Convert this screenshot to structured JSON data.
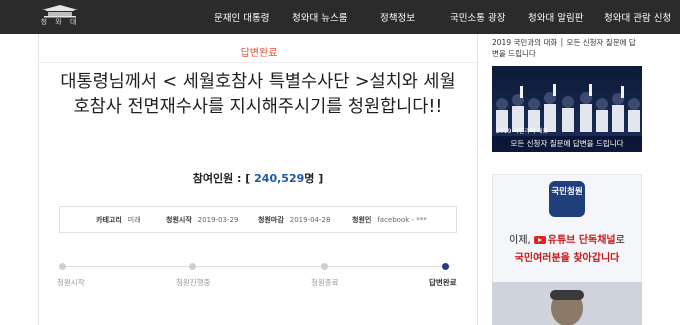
{
  "nav": {
    "logo_text": "청 와 대",
    "items": [
      "문재인 대통령",
      "청와대 뉴스룸",
      "정책정보",
      "국민소통 광장",
      "청와대 알림판",
      "청와대 관람 신청"
    ]
  },
  "petition": {
    "status": "답변완료",
    "title": "대통령님께서 < 세월호참사 특별수사단 >설치와 세월호참사 전면재수사를 지시해주시기를 청원합니다!!",
    "participants_label": "참여인원 : [",
    "participants_value": "240,529",
    "participants_suffix": "명 ]",
    "meta": {
      "category_label": "카테고리",
      "category_value": "미래",
      "start_label": "청원시작",
      "start_value": "2019-03-29",
      "end_label": "청원마감",
      "end_value": "2019-04-28",
      "author_label": "청원인",
      "author_value": "facebook - ***"
    },
    "steps": [
      "청원시작",
      "청원진행중",
      "청원종료",
      "답변완료"
    ]
  },
  "sidebar": {
    "caption": "2019 국민과의 대화 │ 모든 신청자 질문에 답변을 드립니다",
    "card1_sub": "2019 국민과의 대화",
    "card1_banner": "모든 신청자 질문에 답변을 드립니다",
    "badge": "국민청원",
    "card2_line1_a": "이제,",
    "card2_line1_b": "유튜브 단독채널",
    "card2_line1_c": "로",
    "card2_line2": "국민여러분을 찾아갑니다"
  },
  "colors": {
    "nav_bg": "#2b2b2b",
    "accent_red": "#e0533c",
    "accent_blue": "#1f57a6",
    "step_active": "#1f3f7a"
  }
}
